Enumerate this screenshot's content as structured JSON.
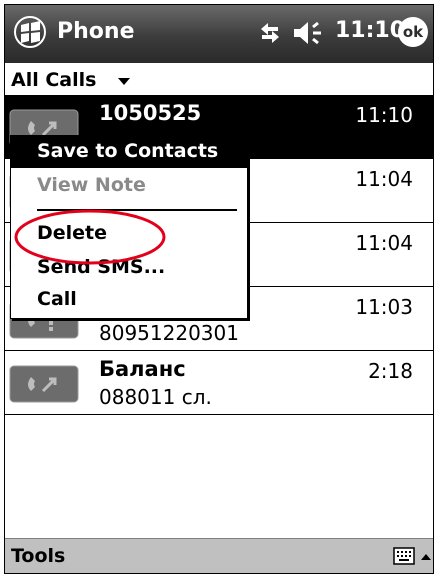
{
  "titlebar": {
    "app_title": "Phone",
    "time": "11:10",
    "ok_label": "ok"
  },
  "filter": {
    "label": "All Calls"
  },
  "calls": [
    {
      "name": "1050525",
      "number": "",
      "time": "11:10"
    },
    {
      "name": "",
      "number": "",
      "time": "11:04"
    },
    {
      "name": "",
      "number": "",
      "time": "11:04"
    },
    {
      "name": "",
      "number": "80951220301",
      "time": "11:03"
    },
    {
      "name": "Баланс",
      "number": "088011 сл.",
      "time": "2:18"
    }
  ],
  "context_menu": {
    "items": [
      "Save to Contacts",
      "View Note",
      "Delete",
      "Send SMS...",
      "Call"
    ]
  },
  "bottombar": {
    "tools_label": "Tools"
  },
  "colors": {
    "highlight": "#000000",
    "annotation": "#e3001b",
    "titlebar": "#3c3c3c"
  }
}
